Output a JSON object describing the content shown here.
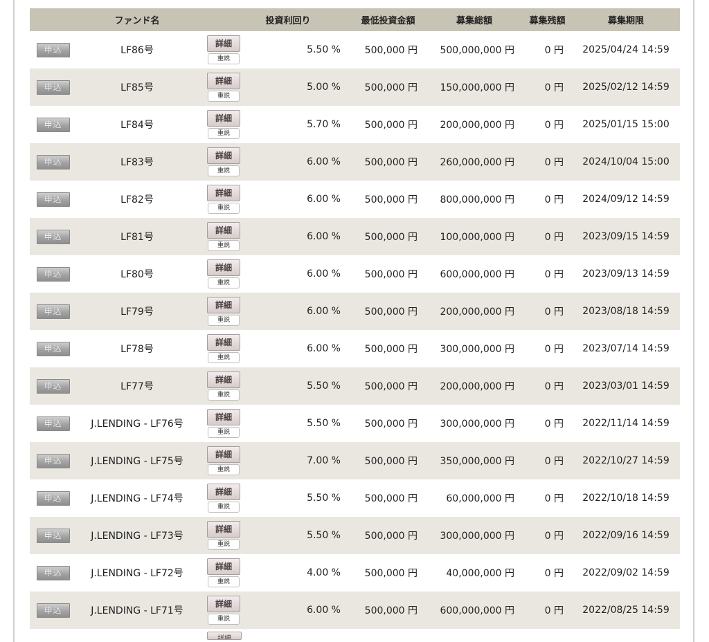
{
  "headers": {
    "apply": "",
    "fund_name": "ファンド名",
    "buttons": "",
    "yield": "投資利回り",
    "min_investment": "最低投資金額",
    "total_amount": "募集総額",
    "remaining": "募集残額",
    "deadline": "募集期限"
  },
  "buttons": {
    "apply_label": "申込",
    "detail_label": "詳細",
    "doc_label": "重説"
  },
  "rows": [
    {
      "name": "LF86号",
      "yield": "5.50 %",
      "min": "500,000 円",
      "total": "500,000,000 円",
      "remaining": "0 円",
      "deadline": "2025/04/24 14:59"
    },
    {
      "name": "LF85号",
      "yield": "5.00 %",
      "min": "500,000 円",
      "total": "150,000,000 円",
      "remaining": "0 円",
      "deadline": "2025/02/12 14:59"
    },
    {
      "name": "LF84号",
      "yield": "5.70 %",
      "min": "500,000 円",
      "total": "200,000,000 円",
      "remaining": "0 円",
      "deadline": "2025/01/15 15:00"
    },
    {
      "name": "LF83号",
      "yield": "6.00 %",
      "min": "500,000 円",
      "total": "260,000,000 円",
      "remaining": "0 円",
      "deadline": "2024/10/04 15:00"
    },
    {
      "name": "LF82号",
      "yield": "6.00 %",
      "min": "500,000 円",
      "total": "800,000,000 円",
      "remaining": "0 円",
      "deadline": "2024/09/12 14:59"
    },
    {
      "name": "LF81号",
      "yield": "6.00 %",
      "min": "500,000 円",
      "total": "100,000,000 円",
      "remaining": "0 円",
      "deadline": "2023/09/15 14:59"
    },
    {
      "name": "LF80号",
      "yield": "6.00 %",
      "min": "500,000 円",
      "total": "600,000,000 円",
      "remaining": "0 円",
      "deadline": "2023/09/13 14:59"
    },
    {
      "name": "LF79号",
      "yield": "6.00 %",
      "min": "500,000 円",
      "total": "200,000,000 円",
      "remaining": "0 円",
      "deadline": "2023/08/18 14:59"
    },
    {
      "name": "LF78号",
      "yield": "6.00 %",
      "min": "500,000 円",
      "total": "300,000,000 円",
      "remaining": "0 円",
      "deadline": "2023/07/14 14:59"
    },
    {
      "name": "LF77号",
      "yield": "5.50 %",
      "min": "500,000 円",
      "total": "200,000,000 円",
      "remaining": "0 円",
      "deadline": "2023/03/01 14:59"
    },
    {
      "name": "J.LENDING - LF76号",
      "yield": "5.50 %",
      "min": "500,000 円",
      "total": "300,000,000 円",
      "remaining": "0 円",
      "deadline": "2022/11/14 14:59"
    },
    {
      "name": "J.LENDING - LF75号",
      "yield": "7.00 %",
      "min": "500,000 円",
      "total": "350,000,000 円",
      "remaining": "0 円",
      "deadline": "2022/10/27 14:59"
    },
    {
      "name": "J.LENDING - LF74号",
      "yield": "5.50 %",
      "min": "500,000 円",
      "total": "60,000,000 円",
      "remaining": "0 円",
      "deadline": "2022/10/18 14:59"
    },
    {
      "name": "J.LENDING - LF73号",
      "yield": "5.50 %",
      "min": "500,000 円",
      "total": "300,000,000 円",
      "remaining": "0 円",
      "deadline": "2022/09/16 14:59"
    },
    {
      "name": "J.LENDING - LF72号",
      "yield": "4.00 %",
      "min": "500,000 円",
      "total": "40,000,000 円",
      "remaining": "0 円",
      "deadline": "2022/09/02 14:59"
    },
    {
      "name": "J.LENDING - LF71号",
      "yield": "6.00 %",
      "min": "500,000 円",
      "total": "600,000,000 円",
      "remaining": "0 円",
      "deadline": "2022/08/25 14:59"
    }
  ]
}
